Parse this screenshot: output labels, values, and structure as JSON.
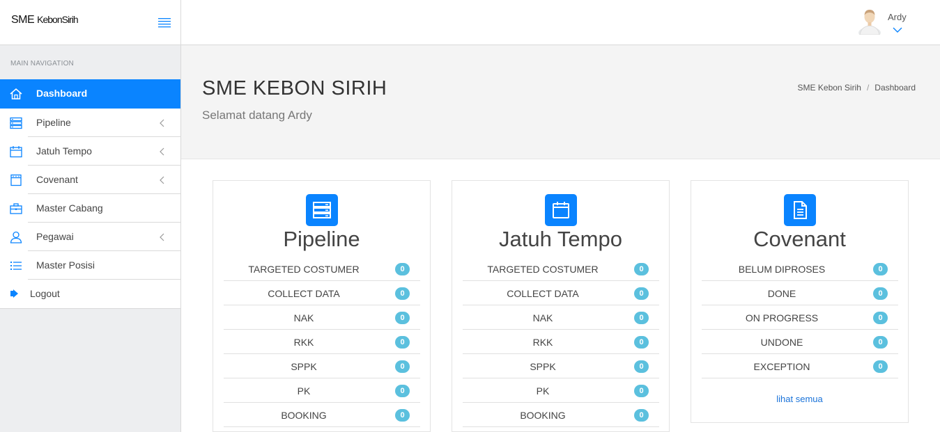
{
  "header": {
    "brand_main": "SME",
    "brand_sub": "KebonSirih",
    "user_name": "Ardy"
  },
  "sidebar": {
    "section_label": "MAIN NAVIGATION",
    "items": [
      {
        "label": "Dashboard",
        "icon": "home-icon",
        "active": true
      },
      {
        "label": "Pipeline",
        "icon": "server-list-icon",
        "has_submenu": true
      },
      {
        "label": "Jatuh Tempo",
        "icon": "calendar-icon",
        "has_submenu": true
      },
      {
        "label": "Covenant",
        "icon": "calendar-grid-icon",
        "has_submenu": true
      },
      {
        "label": "Master Cabang",
        "icon": "briefcase-icon"
      },
      {
        "label": "Pegawai",
        "icon": "user-icon",
        "has_submenu": true
      },
      {
        "label": "Master Posisi",
        "icon": "list-icon"
      },
      {
        "label": "Logout",
        "icon": "logout-icon"
      }
    ]
  },
  "content": {
    "title": "SME KEBON SIRIH",
    "subtitle": "Selamat datang Ardy",
    "breadcrumb": [
      "SME Kebon Sirih",
      "Dashboard"
    ]
  },
  "cards": [
    {
      "title": "Pipeline",
      "icon": "server-icon",
      "rows": [
        {
          "label": "TARGETED COSTUMER",
          "count": "0"
        },
        {
          "label": "COLLECT DATA",
          "count": "0"
        },
        {
          "label": "NAK",
          "count": "0"
        },
        {
          "label": "RKK",
          "count": "0"
        },
        {
          "label": "SPPK",
          "count": "0"
        },
        {
          "label": "PK",
          "count": "0"
        },
        {
          "label": "BOOKING",
          "count": "0"
        }
      ]
    },
    {
      "title": "Jatuh Tempo",
      "icon": "calendar-icon",
      "rows": [
        {
          "label": "TARGETED COSTUMER",
          "count": "0"
        },
        {
          "label": "COLLECT DATA",
          "count": "0"
        },
        {
          "label": "NAK",
          "count": "0"
        },
        {
          "label": "RKK",
          "count": "0"
        },
        {
          "label": "SPPK",
          "count": "0"
        },
        {
          "label": "PK",
          "count": "0"
        },
        {
          "label": "BOOKING",
          "count": "0"
        }
      ]
    },
    {
      "title": "Covenant",
      "icon": "document-icon",
      "rows": [
        {
          "label": "BELUM DIPROSES",
          "count": "0"
        },
        {
          "label": "DONE",
          "count": "0"
        },
        {
          "label": "ON PROGRESS",
          "count": "0"
        },
        {
          "label": "UNDONE",
          "count": "0"
        },
        {
          "label": "EXCEPTION",
          "count": "0"
        }
      ],
      "see_all": "lihat semua"
    }
  ],
  "colors": {
    "accent": "#0a84ff",
    "badge": "#5bc0de",
    "sidebar_bg": "#edeef0"
  }
}
